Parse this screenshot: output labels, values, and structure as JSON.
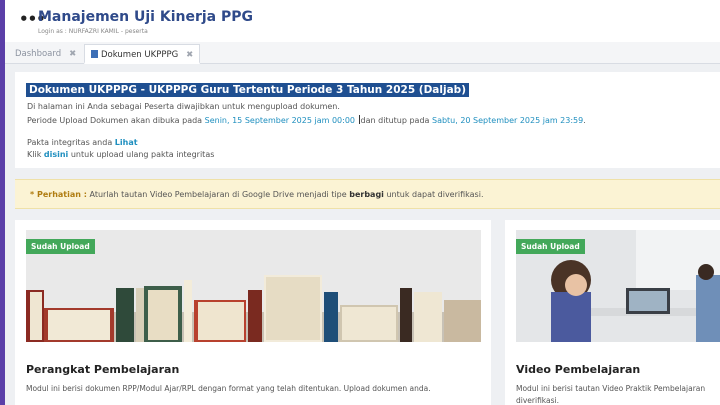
{
  "header": {
    "title": "Manajemen Uji Kinerja PPG",
    "login_info": "Login as : NURFAZRI KAMIL - peserta"
  },
  "tabs": [
    {
      "label": "Dashboard"
    },
    {
      "label": "Dokumen UKPPPG"
    }
  ],
  "info": {
    "doc_title": "Dokumen UKPPPG - UKPPPG Guru Tertentu Periode 3 Tahun 2025 (Daljab)",
    "line1": "Di halaman ini Anda sebagai Peserta diwajibkan untuk mengupload dokumen.",
    "line2_pre": "Periode Upload Dokumen akan dibuka pada",
    "open_date": "Senin, 15 September 2025 jam 00:00",
    "line2_mid": "dan ditutup pada",
    "close_date": "Sabtu, 20 September 2025 jam 23:59",
    "line2_end": ".",
    "pakta_pre": "Pakta integritas anda",
    "pakta_link": "Lihat",
    "upload_pre": "Klik",
    "upload_link": "disini",
    "upload_post": "untuk upload ulang pakta integritas"
  },
  "notice": {
    "label": "* Perhatian :",
    "text_pre": "Aturlah tautan Video Pembelajaran di Google Drive menjadi tipe",
    "bold": "berbagi",
    "text_post": "untuk dapat diverifikasi."
  },
  "cards": [
    {
      "badge": "Sudah Upload",
      "title": "Perangkat Pembelajaran",
      "desc": "Modul ini berisi dokumen RPP/Modul Ajar/RPL dengan format yang telah ditentukan. Upload dokumen anda."
    },
    {
      "badge": "Sudah Upload",
      "title": "Video Pembelajaran",
      "desc": "Modul ini berisi tautan Video Praktik Pembelajaran diverifikasi."
    }
  ],
  "colors": {
    "brand": "#2f4a8a",
    "highlight": "#1f4f91",
    "link": "#1f8fbf",
    "badge": "#43a85a",
    "notice_bg": "#fbf3d4"
  }
}
